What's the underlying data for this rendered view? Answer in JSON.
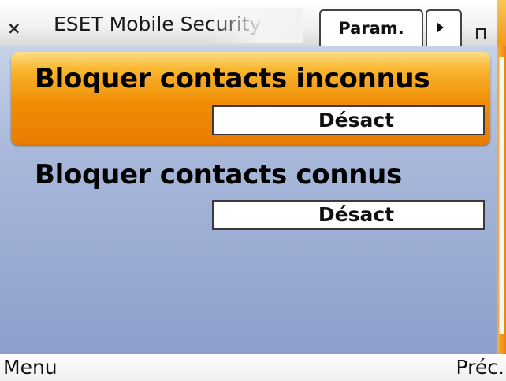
{
  "title_bar": {
    "close_glyph": "×",
    "app_title": "ESET Mobile Security",
    "active_tab": "Param."
  },
  "settings": [
    {
      "label": "Bloquer contacts inconnus",
      "value": "Désact",
      "selected": true
    },
    {
      "label": "Bloquer contacts connus",
      "value": "Désact",
      "selected": false
    }
  ],
  "softkeys": {
    "left": "Menu",
    "right": "Préc."
  },
  "colors": {
    "highlight": "#f08d05",
    "background": "#a8b8da",
    "accent": "#f29a16"
  }
}
